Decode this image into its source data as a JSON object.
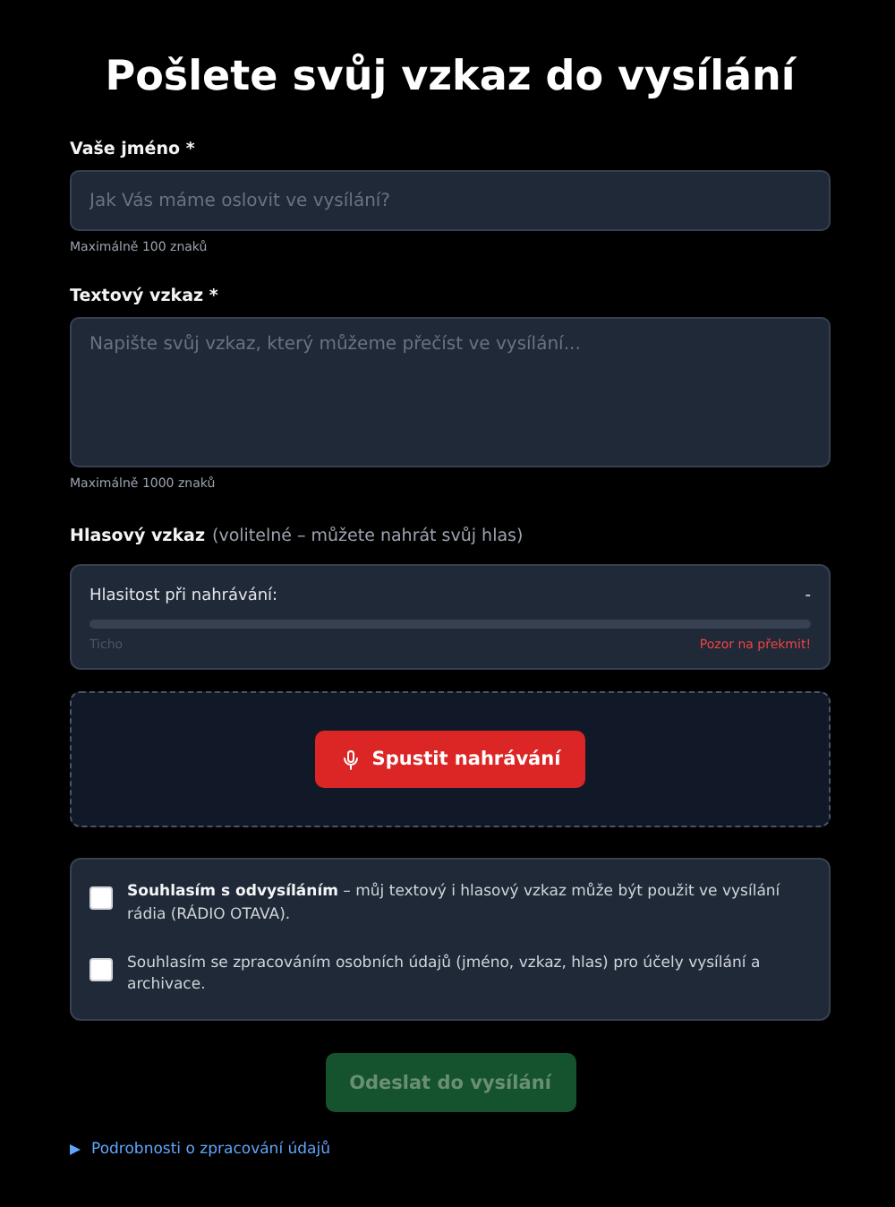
{
  "title": "Pošlete svůj vzkaz do vysílání",
  "name_field": {
    "label": "Vaše jméno *",
    "placeholder": "Jak Vás máme oslovit ve vysílání?",
    "hint": "Maximálně 100 znaků"
  },
  "message_field": {
    "label": "Textový vzkaz *",
    "placeholder": "Napište svůj vzkaz, který můžeme přečíst ve vysílání...",
    "hint": "Maximálně 1000 znaků"
  },
  "voice": {
    "label": "Hlasový vzkaz",
    "note": "(volitelné – můžete nahrát svůj hlas)"
  },
  "meter": {
    "label": "Hlasitost při nahrávání:",
    "reading": "-",
    "low_label": "Ticho",
    "high_label": "Pozor na překmit!"
  },
  "record_button": {
    "label": "Spustit nahrávání"
  },
  "consents": [
    {
      "text": "**Souhlasím s odvysíláním** – můj textový i hlasový vzkaz může být použit ve vysílání rádia (RÁDIO OTAVA).",
      "checked": false
    },
    {
      "text": "Souhlasím se zpracováním osobních údajů (jméno, vzkaz, hlas) pro účely vysílání a archivace.",
      "checked": false
    }
  ],
  "submit_button": {
    "label": "Odeslat do vysílání",
    "disabled": true
  },
  "details": {
    "label": "Podrobnosti o zpracování údajů",
    "expanded": false
  }
}
